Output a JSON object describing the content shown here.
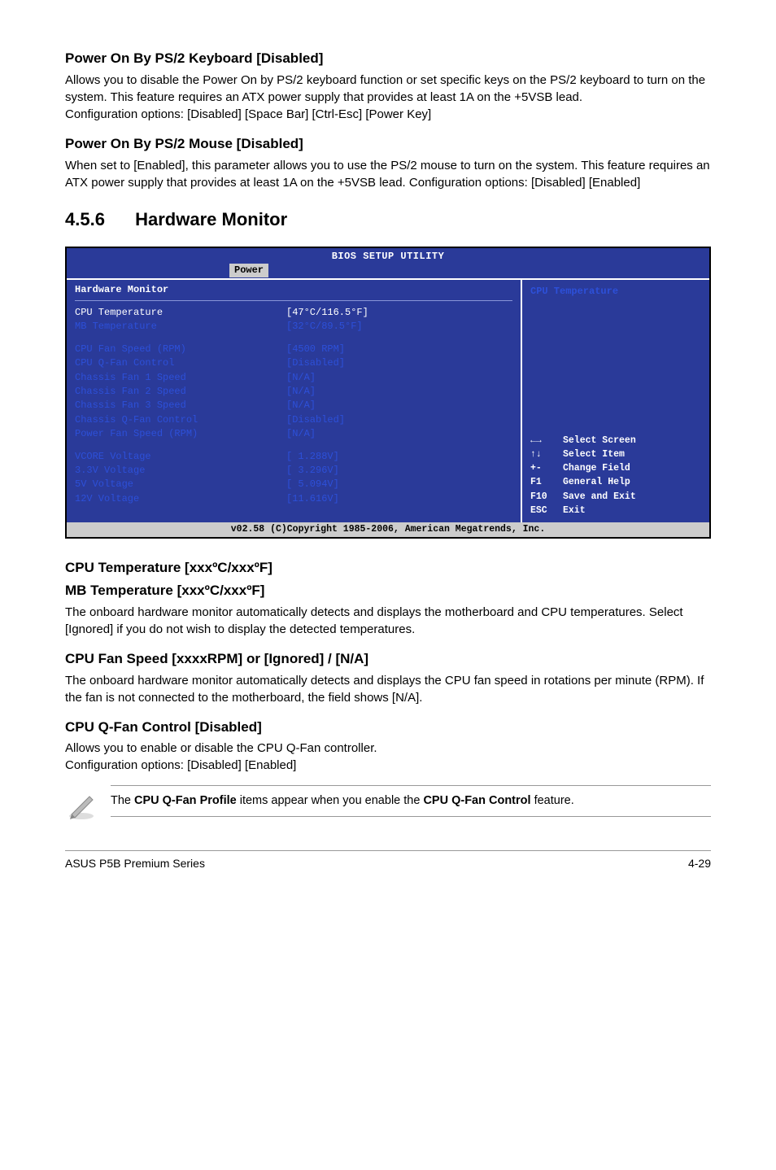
{
  "s1": {
    "h": "Power On By PS/2 Keyboard [Disabled]",
    "p1": "Allows you to disable the Power On by PS/2 keyboard function or set specific keys on the PS/2 keyboard to turn on the system. This feature requires an ATX power supply that provides at least 1A on the +5VSB lead.",
    "p2": "Configuration options: [Disabled] [Space Bar] [Ctrl-Esc] [Power Key]"
  },
  "s2": {
    "h": "Power On By PS/2 Mouse [Disabled]",
    "p": "When set to [Enabled], this parameter allows you to use the PS/2 mouse to turn on the system. This feature requires an ATX power supply that provides at least 1A on the +5VSB lead. Configuration options: [Disabled] [Enabled]"
  },
  "mainh": {
    "num": "4.5.6",
    "title": "Hardware Monitor"
  },
  "bios": {
    "title": "BIOS SETUP UTILITY",
    "tab": "Power",
    "panel_title": "Hardware Monitor",
    "rows": [
      {
        "label": "CPU Temperature",
        "val": "[47°C/116.5°F]",
        "current": true
      },
      {
        "label": "MB Temperature",
        "val": "[32°C/89.5°F]"
      }
    ],
    "rows2": [
      {
        "label": "CPU Fan Speed (RPM)",
        "val": "[4500 RPM]"
      },
      {
        "label": "CPU Q-Fan Control",
        "val": "[Disabled]"
      },
      {
        "label": "Chassis Fan 1 Speed",
        "val": "[N/A]"
      },
      {
        "label": "Chassis Fan 2 Speed",
        "val": "[N/A]"
      },
      {
        "label": "Chassis Fan 3 Speed",
        "val": "[N/A]"
      },
      {
        "label": "Chassis Q-Fan Control",
        "val": "[Disabled]"
      },
      {
        "label": "Power Fan Speed (RPM)",
        "val": "[N/A]"
      }
    ],
    "rows3": [
      {
        "label": "VCORE Voltage",
        "val": "[ 1.288V]"
      },
      {
        "label": "3.3V Voltage",
        "val": "[ 3.296V]"
      },
      {
        "label": "5V Voltage",
        "val": "[ 5.094V]"
      },
      {
        "label": "12V Voltage",
        "val": "[11.616V]"
      }
    ],
    "help_title": "CPU Temperature",
    "keys": [
      {
        "k": "←→",
        "d": "Select Screen"
      },
      {
        "k": "↑↓",
        "d": "Select Item"
      },
      {
        "k": "+-",
        "d": "Change Field"
      },
      {
        "k": "F1",
        "d": "General Help"
      },
      {
        "k": "F10",
        "d": "Save and Exit"
      },
      {
        "k": "ESC",
        "d": "Exit"
      }
    ],
    "footer": "v02.58 (C)Copyright 1985-2006, American Megatrends, Inc."
  },
  "s3": {
    "h1": "CPU Temperature [xxxºC/xxxºF]",
    "h2": "MB Temperature [xxxºC/xxxºF]",
    "p": "The onboard hardware monitor automatically detects and displays the motherboard and CPU temperatures. Select [Ignored] if you do not wish to display the detected temperatures."
  },
  "s4": {
    "h": "CPU Fan Speed [xxxxRPM] or [Ignored] / [N/A]",
    "p": "The onboard hardware monitor automatically detects and displays the CPU fan speed in rotations per minute (RPM). If the fan is not connected to the motherboard, the field shows [N/A]."
  },
  "s5": {
    "h": "CPU Q-Fan Control [Disabled]",
    "p1": "Allows you to enable or disable the CPU Q-Fan controller.",
    "p2": "Configuration options: [Disabled] [Enabled]"
  },
  "note": {
    "pre": "The ",
    "b1": "CPU Q-Fan Profile",
    "mid": " items appear when you enable the ",
    "b2": "CPU Q-Fan Control",
    "post": " feature."
  },
  "footer": {
    "left": "ASUS P5B Premium Series",
    "right": "4-29"
  }
}
